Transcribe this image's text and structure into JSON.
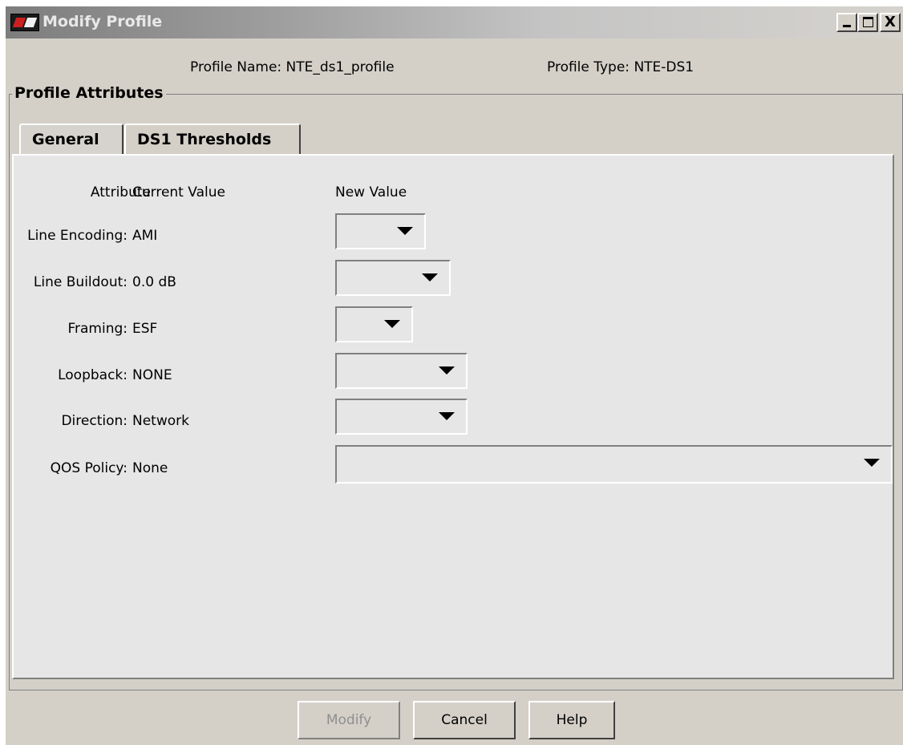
{
  "window": {
    "title": "Modify Profile",
    "close_glyph": "X"
  },
  "header": {
    "profile_name": "Profile Name:  NTE_ds1_profile",
    "profile_type": "Profile Type:  NTE-DS1"
  },
  "group": {
    "legend": "Profile Attributes"
  },
  "tabs": [
    {
      "label": "General",
      "selected": true
    },
    {
      "label": "DS1 Thresholds",
      "selected": false
    }
  ],
  "table": {
    "headers": {
      "attribute": "Attribute",
      "current": "Current Value",
      "new": "New Value"
    },
    "rows": [
      {
        "label": "Line Encoding:",
        "current": "AMI",
        "new_value": ""
      },
      {
        "label": "Line Buildout:",
        "current": "0.0 dB",
        "new_value": ""
      },
      {
        "label": "Framing:",
        "current": "ESF",
        "new_value": ""
      },
      {
        "label": "Loopback:",
        "current": "NONE",
        "new_value": ""
      },
      {
        "label": "Direction:",
        "current": "Network",
        "new_value": ""
      },
      {
        "label": "QOS Policy:",
        "current": "None",
        "new_value": ""
      }
    ]
  },
  "buttons": {
    "modify": "Modify",
    "cancel": "Cancel",
    "help": "Help"
  },
  "icons": {
    "app": "app-logo-icon",
    "minimize": "minimize-icon",
    "maximize": "maximize-icon",
    "close": "close-icon",
    "dropdown": "chevron-down-icon"
  }
}
